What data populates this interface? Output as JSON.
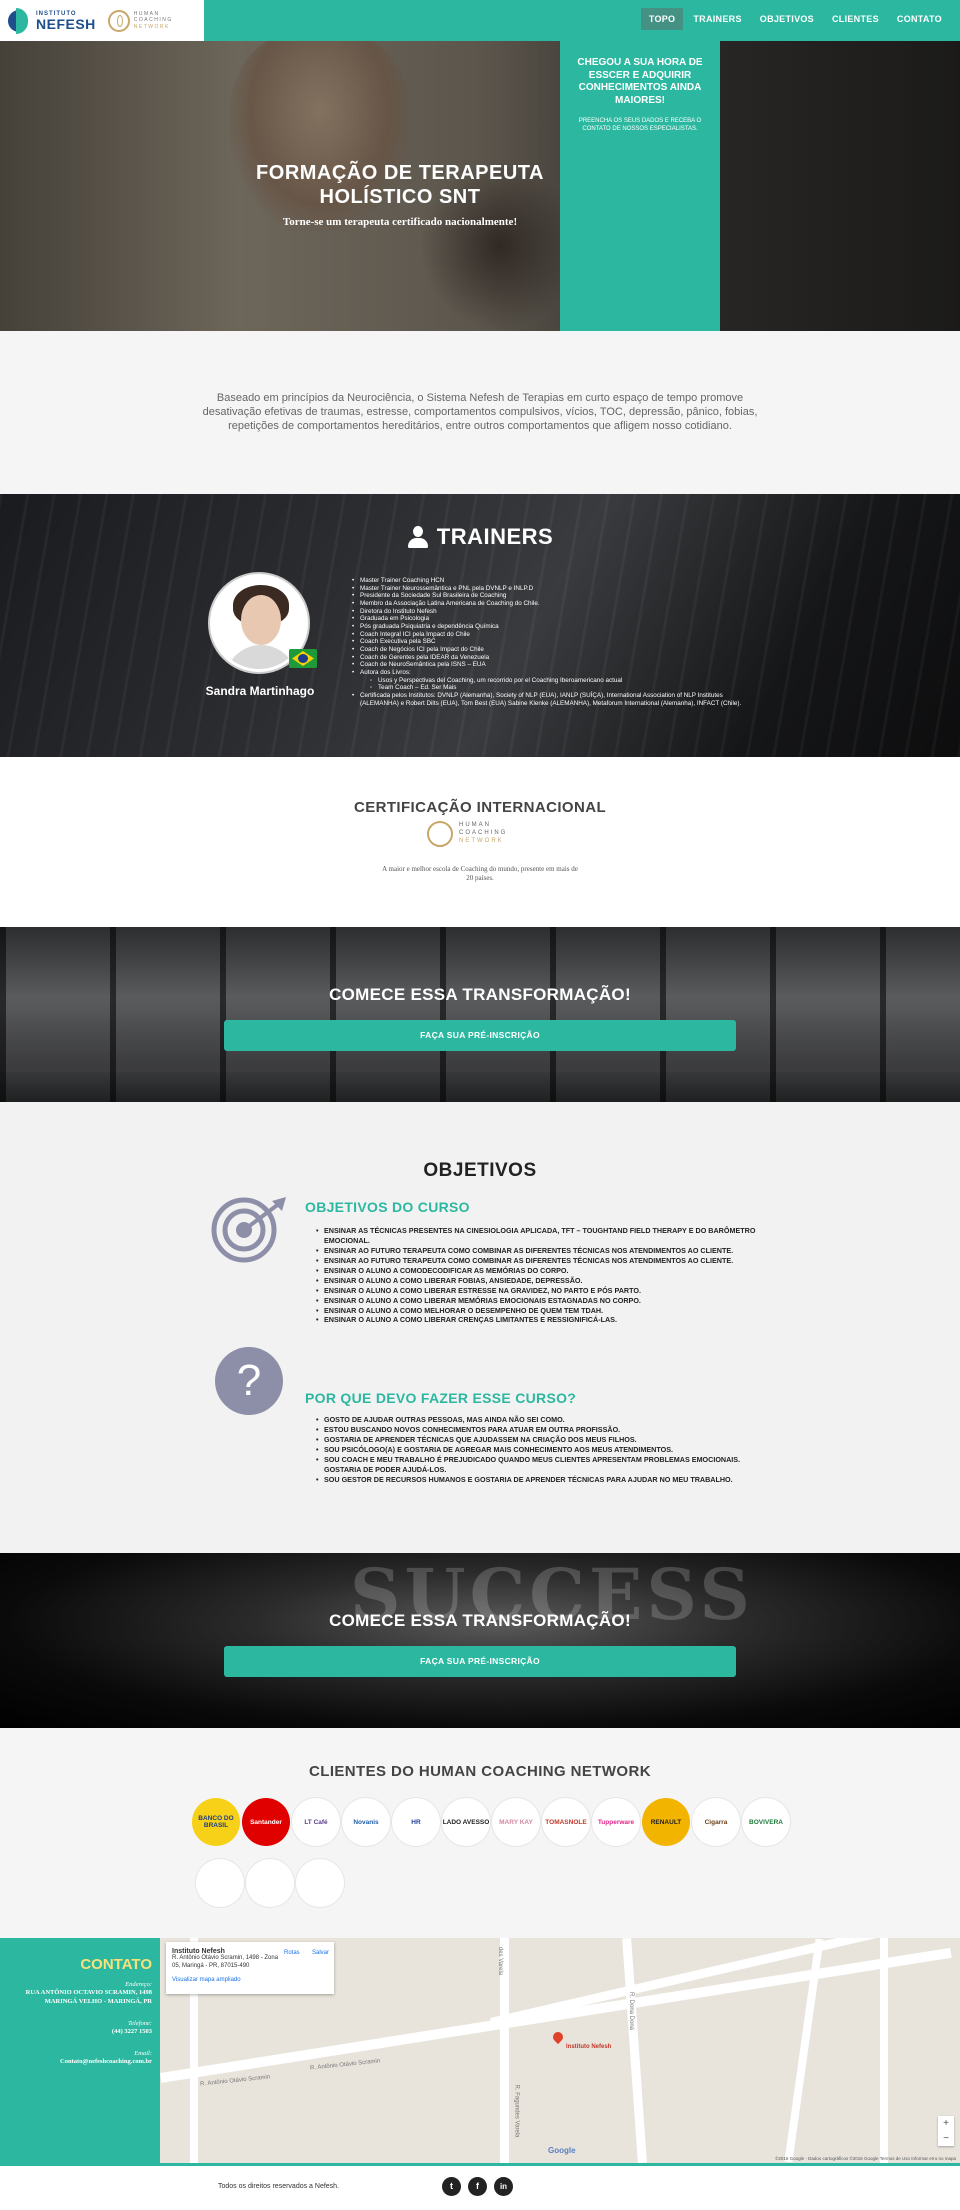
{
  "header": {
    "logo_top": "INSTITUTO",
    "logo_name": "NEFESH",
    "hcn_lines": [
      "HUMAN",
      "COACHING",
      "NETWORK"
    ],
    "nav": [
      "TOPO",
      "TRAINERS",
      "OBJETIVOS",
      "CLIENTES",
      "CONTATO"
    ],
    "active": "TOPO"
  },
  "hero": {
    "title": "FORMAÇÃO DE TERAPEUTA HOLÍSTICO SNT",
    "subtitle": "Torne-se um terapeuta certificado nacionalmente!",
    "box_heading": "CHEGOU A SUA HORA DE ESSCER E ADQUIRIR CONHECIMENTOS AINDA MAIORES!",
    "box_text": "PREENCHA OS SEUS DADOS E RECEBA O CONTATO DE NOSSOS ESPECIALISTAS."
  },
  "intro": {
    "text": "Baseado em princípios da Neurociência, o Sistema Nefesh de Terapias em curto espaço de tempo promove desativação efetivas de traumas, estresse, comportamentos compulsivos, vícios, TOC, depressão, pânico, fobias, repetições de comportamentos hereditários, entre outros comportamentos que afligem nosso cotidiano."
  },
  "trainers": {
    "title": "TRAINERS",
    "name": "Sandra Martinhago",
    "items": [
      "Master Trainer Coaching HCN",
      "Master Trainer Neurossemântica e PNL pela DVNLP e INLP.D",
      "Presidente da Sociedade Sul Brasileira de Coaching",
      "Membro da Associação Latina Americana de Coaching do Chile.",
      "Diretora do Instituto Nefesh",
      "Graduada em Psicologia",
      "Pós graduada Psiquiatria e dependência Química",
      "Coach Integral ICI pela Impact do Chile",
      "Coach Executiva pela SBC",
      "Coach de Negócios ICI pela Impact do Chile",
      "Coach de Gerentes pela IDEAR da Venezuela",
      "Coach de NeuroSemântica pela ISNS – EUA",
      "Autora dos Livros:"
    ],
    "sub_items": [
      "Usos y Perspectivas del Coaching, um recorrido por el Coaching Iberoamericano actual",
      "Team Coach – Ed. Ser Mais"
    ],
    "last_item": "Certificada pelos Institutos: DVNLP (Alemanha), Society of NLP (EUA), IANLP (SUÍÇA), International Association of NLP Institutes (ALEMANHA) e Robert Dilts (EUA), Tom Best (EUA) Sabine Klenke (ALEMANHA), Metaforum International (Alemanha), INFACT (Chile)."
  },
  "cert": {
    "title": "CERTIFICAÇÃO INTERNACIONAL",
    "logo_lines": [
      "HUMAN",
      "COACHING",
      "NETWORK"
    ],
    "text": "A maior e melhor escola de Coaching do mundo, presente em mais de 20 países."
  },
  "cta": {
    "heading": "COMECE ESSA TRANSFORMAÇÃO!",
    "button": "FAÇA SUA PRÉ-INSCRIÇÃO",
    "chalk_text": "SUCCESS"
  },
  "objetivos": {
    "title": "OBJETIVOS",
    "course_heading": "OBJETIVOS DO CURSO",
    "course_items": [
      "ENSINAR AS TÉCNICAS PRESENTES NA CINESIOLOGIA APLICADA, TFT – TOUGHTAND FIELD THERAPY E DO BARÔMETRO EMOCIONAL.",
      "ENSINAR AO FUTURO TERAPEUTA COMO COMBINAR AS DIFERENTES TÉCNICAS NOS ATENDIMENTOS AO CLIENTE.",
      "ENSINAR AO FUTURO TERAPEUTA COMO COMBINAR AS DIFERENTES TÉCNICAS NOS ATENDIMENTOS AO CLIENTE.",
      "ENSINAR O ALUNO A COMODECODIFICAR AS MEMÓRIAS DO CORPO.",
      "ENSINAR O ALUNO A COMO LIBERAR FOBIAS, ANSIEDADE, DEPRESSÃO.",
      "ENSINAR O ALUNO A COMO LIBERAR ESTRESSE NA GRAVIDEZ, NO PARTO E PÓS PARTO.",
      "ENSINAR O ALUNO A COMO LIBERAR MEMÓRIAS EMOCIONAIS ESTAGNADAS NO CORPO.",
      "ENSINAR O ALUNO A COMO MELHORAR O DESEMPENHO DE QUEM TEM TDAH.",
      "ENSINAR O ALUNO A COMO LIBERAR CRENÇAS LIMITANTES E RESSIGNIFICÁ-LAS."
    ],
    "why_heading": "POR QUE DEVO FAZER ESSE CURSO?",
    "why_items": [
      "GOSTO DE AJUDAR OUTRAS PESSOAS, MAS AINDA NÃO SEI COMO.",
      "ESTOU BUSCANDO NOVOS CONHECIMENTOS PARA ATUAR EM OUTRA PROFISSÃO.",
      "GOSTARIA DE APRENDER TÉCNICAS QUE AJUDASSEM NA CRIAÇÃO DOS MEUS FILHOS.",
      "SOU PSICÓLOGO(A) E GOSTARIA DE AGREGAR MAIS CONHECIMENTO AOS MEUS ATENDIMENTOS.",
      "SOU COACH E MEU TRABALHO É PREJUDICADO QUANDO MEUS CLIENTES APRESENTAM PROBLEMAS EMOCIONAIS. GOSTARIA DE PODER AJUDÁ-LOS.",
      "SOU GESTOR DE RECURSOS HUMANOS E GOSTARIA DE APRENDER TÉCNICAS PARA AJUDAR NO MEU TRABALHO."
    ]
  },
  "clients": {
    "title": "CLIENTES DO HUMAN COACHING NETWORK",
    "logos": [
      {
        "label": "BANCO DO BRASIL",
        "bg": "#f7d117",
        "fg": "#1c3c8a"
      },
      {
        "label": "Santander",
        "bg": "#e00000",
        "fg": "#ffffff"
      },
      {
        "label": "LT Café",
        "bg": "#ffffff",
        "fg": "#5a3e8a"
      },
      {
        "label": "Novanis",
        "bg": "#ffffff",
        "fg": "#1f5fa8"
      },
      {
        "label": "HR",
        "bg": "#ffffff",
        "fg": "#1f3f9a"
      },
      {
        "label": "LADO AVESSO",
        "bg": "#ffffff",
        "fg": "#222222"
      },
      {
        "label": "MARY KAY",
        "bg": "#ffffff",
        "fg": "#d18aa0"
      },
      {
        "label": "TOMASNOLE",
        "bg": "#ffffff",
        "fg": "#c0392b"
      },
      {
        "label": "Tupperware",
        "bg": "#ffffff",
        "fg": "#e0248a"
      },
      {
        "label": "RENAULT",
        "bg": "#f3b400",
        "fg": "#222222"
      },
      {
        "label": "Cigarra",
        "bg": "#ffffff",
        "fg": "#6b3e1a"
      },
      {
        "label": "BOVIVERA",
        "bg": "#ffffff",
        "fg": "#1e7a3b"
      },
      {
        "label": "",
        "bg": "#ffffff",
        "fg": "#333333"
      },
      {
        "label": "",
        "bg": "#ffffff",
        "fg": "#c0392b"
      },
      {
        "label": "",
        "bg": "#ffffff",
        "fg": "#c0392b"
      }
    ]
  },
  "contact": {
    "title": "CONTATO",
    "address_label": "Endereço:",
    "address": "RUA ANTÔNIO OCTAVIO SCRAMIN, 1498 MARINGÁ VELHO - MARINGÁ, PR",
    "phone_label": "Telefone:",
    "phone": "(44) 3227 1503",
    "email_label": "Email:",
    "email": "Contato@nefeshcoaching.com.br"
  },
  "map": {
    "place": "Instituto Nefesh",
    "address": "R. Antônio Otávio Scramin, 1498 - Zona 05, Maringá - PR, 87015-490",
    "routes": "Rotas",
    "save": "Salvar",
    "link": "Visualizar mapa ampliado",
    "pin_label": "Instituto Nefesh",
    "streets": [
      "R. Antônio Otávio Scramin",
      "R. Antônio Otávio Scramin",
      "R. Fagundes Varela",
      "R. Dona Doná",
      "des Varela"
    ],
    "google": "Google",
    "copyright": "©2016 Google · Dados cartográficos ©2016 Google   Termos de Uso   Informar erro no mapa"
  },
  "footer": {
    "copyright": "Todos os direitos reservados a Nefesh.",
    "social": [
      "t",
      "f",
      "in"
    ]
  }
}
